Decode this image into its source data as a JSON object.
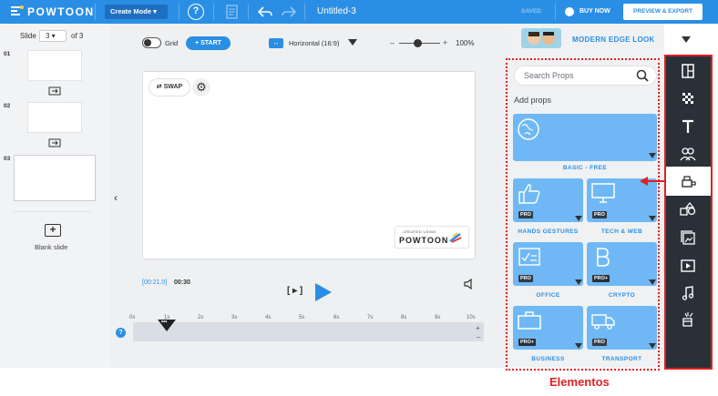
{
  "topbar": {
    "logo_text": "POWTOON",
    "mode_label": "Create Mode ▾",
    "help_glyph": "?",
    "doc_title": "Untitled-3",
    "saved_label": "SAVED",
    "buy_now_label": "BUY NOW",
    "export_label": "PREVIEW & EXPORT",
    "accent_color": "#2a8fe4"
  },
  "slides": {
    "label": "Slide",
    "current": "3",
    "of_label": "of 3",
    "items": [
      {
        "number": "01"
      },
      {
        "number": "02"
      },
      {
        "number": "03"
      }
    ],
    "blank_slide_label": "Blank slide"
  },
  "canvas": {
    "grid_label": "Grid",
    "start_label": "+ START",
    "orientation_label": "Horizontal (16:9)",
    "zoom_minus": "–",
    "zoom_plus": "+",
    "zoom_label": "100%",
    "swap_label": "⇄ SWAP",
    "settings_glyph": "⚙",
    "watermark_small": "CREATED USING",
    "watermark_big": "POWTOON"
  },
  "timeline": {
    "current_time": "[00:21.0]",
    "total_time": "00:30",
    "preview_label": "[ ▸ ]",
    "ticks": [
      "0s",
      "1s",
      "2s",
      "3s",
      "4s",
      "5s",
      "6s",
      "7s",
      "8s",
      "9s",
      "10s"
    ],
    "playhead_label": "•••",
    "help_glyph": "?",
    "zoom_in": "+",
    "zoom_out": "–"
  },
  "props": {
    "look_label": "MODERN EDGE LOOK",
    "search_placeholder": "Search Props",
    "add_props_label": "Add props",
    "tiles": [
      {
        "label": "BASIC - FREE",
        "icon": "globe-icon",
        "badge": ""
      },
      {
        "label": "HANDS GESTURES",
        "icon": "thumbs-up-icon",
        "badge": "PRO"
      },
      {
        "label": "TECH & WEB",
        "icon": "monitor-icon",
        "badge": "PRO"
      },
      {
        "label": "OFFICE",
        "icon": "check-sheet-icon",
        "badge": "PRO"
      },
      {
        "label": "CRYPTO",
        "icon": "bitcoin-icon",
        "badge": "PRO+"
      },
      {
        "label": "BUSINESS",
        "icon": "briefcase-icon",
        "badge": "PRO+"
      },
      {
        "label": "TRANSPORT",
        "icon": "truck-icon",
        "badge": "PRO"
      }
    ]
  },
  "annotation": {
    "label": "Elementos",
    "color": "#e02020"
  },
  "iconbar": {
    "icons": [
      "layout-icon",
      "background-icon",
      "text-icon",
      "characters-icon",
      "props-icon",
      "shapes-icon",
      "media-icon",
      "video-icon",
      "music-icon",
      "effects-icon"
    ],
    "active": "props-icon"
  }
}
